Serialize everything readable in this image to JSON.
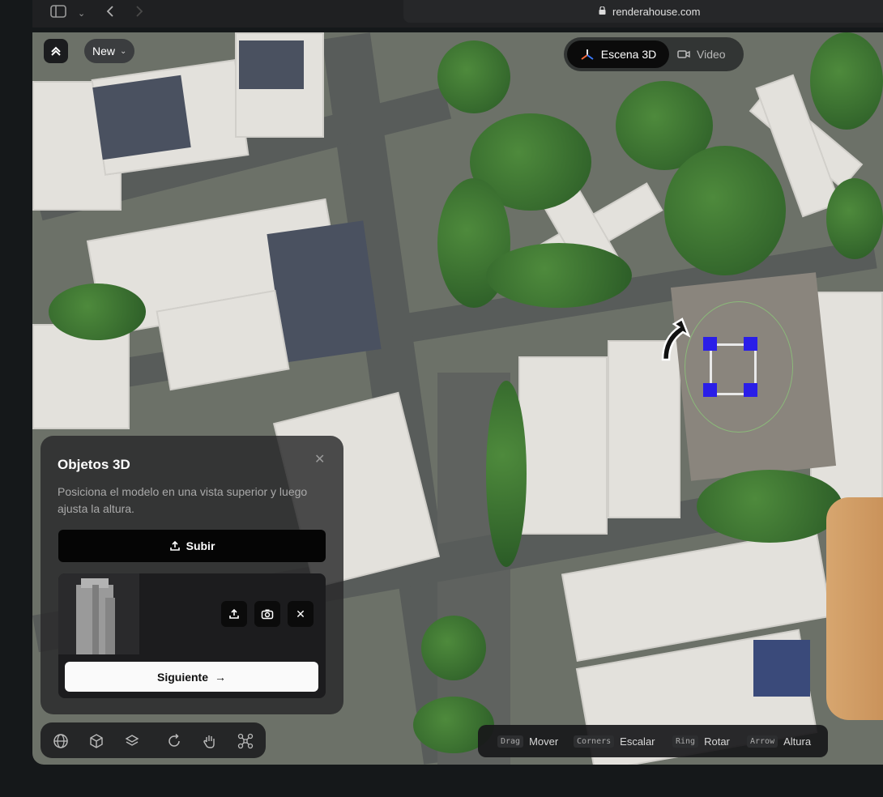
{
  "browser": {
    "url": "renderahouse.com",
    "colors": {
      "bar": "#1f2022"
    }
  },
  "top_left": {
    "menu_icon": "double-chevron-up-icon",
    "new_label": "New"
  },
  "mode_switch": {
    "scene_label": "Escena 3D",
    "video_label": "Video"
  },
  "panel": {
    "title": "Objetos 3D",
    "description": "Posiciona el modelo en una vista superior y luego ajusta la altura.",
    "upload_label": "Subir",
    "next_label": "Siguiente"
  },
  "hints": [
    {
      "key": "Drag",
      "label": "Mover"
    },
    {
      "key": "Corners",
      "label": "Escalar"
    },
    {
      "key": "Ring",
      "label": "Rotar"
    },
    {
      "key": "Arrow",
      "label": "Altura"
    }
  ],
  "toolbar": {
    "tools": [
      "globe-grid-icon",
      "cube-add-icon",
      "layers-icon",
      "rotate-icon",
      "hand-icon",
      "drone-icon"
    ]
  },
  "colors": {
    "accent": "#2a1ee8",
    "selection_ring": "#8cdc78"
  }
}
